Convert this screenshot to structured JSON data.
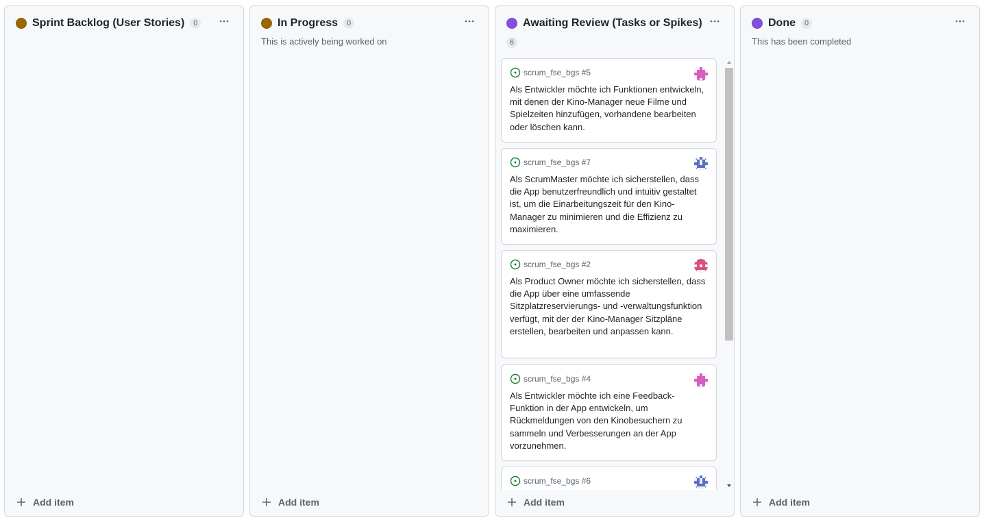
{
  "colors": {
    "status_yellow": "#9a6700",
    "status_purple": "#8250df",
    "open_issue_green": "#1a7f37"
  },
  "columns": [
    {
      "title": "Sprint Backlog (User Stories)",
      "count": "0",
      "description": "",
      "status_color": "#9a6700",
      "add_item_label": "Add item"
    },
    {
      "title": "In Progress",
      "count": "0",
      "description": "This is actively being worked on",
      "status_color": "#9a6700",
      "add_item_label": "Add item"
    },
    {
      "title": "Awaiting Review (Tasks or Spikes)",
      "count": "6",
      "description": "",
      "status_color": "#8250df",
      "add_item_label": "Add item",
      "cards": [
        {
          "ref": "scrum_fse_bgs #5",
          "text": "Als Entwickler möchte ich Funktionen entwickeln, mit denen der Kino-Manager neue Filme und Spielzeiten hinzufügen, vorhandene bearbeiten oder löschen kann.",
          "avatar_icon": "pink-identicon-avatar"
        },
        {
          "ref": "scrum_fse_bgs #7",
          "text": "Als ScrumMaster möchte ich sicherstellen, dass die App benutzerfreundlich und intuitiv gestaltet ist, um die Einarbeitungszeit für den Kino-Manager zu minimieren und die Effizienz zu maximieren.",
          "avatar_icon": "blue-identicon-avatar"
        },
        {
          "ref": "scrum_fse_bgs #2",
          "text": "Als Product Owner möchte ich sicherstellen, dass die App über eine umfassende Sitzplatzreservierungs- und -verwaltungsfunktion verfügt, mit der der Kino-Manager Sitzpläne erstellen, bearbeiten und anpassen kann.",
          "avatar_icon": "red-identicon-avatar"
        },
        {
          "ref": "scrum_fse_bgs #4",
          "text": "Als Entwickler möchte ich eine Feedback-Funktion in der App entwickeln, um Rückmeldungen von den Kinobesuchern zu sammeln und Verbesserungen an der App vorzunehmen.",
          "avatar_icon": "pink-identicon-avatar"
        },
        {
          "ref": "scrum_fse_bgs #6",
          "text": "",
          "avatar_icon": "blue-identicon-avatar"
        }
      ]
    },
    {
      "title": "Done",
      "count": "0",
      "description": "This has been completed",
      "status_color": "#8250df",
      "add_item_label": "Add item"
    }
  ]
}
